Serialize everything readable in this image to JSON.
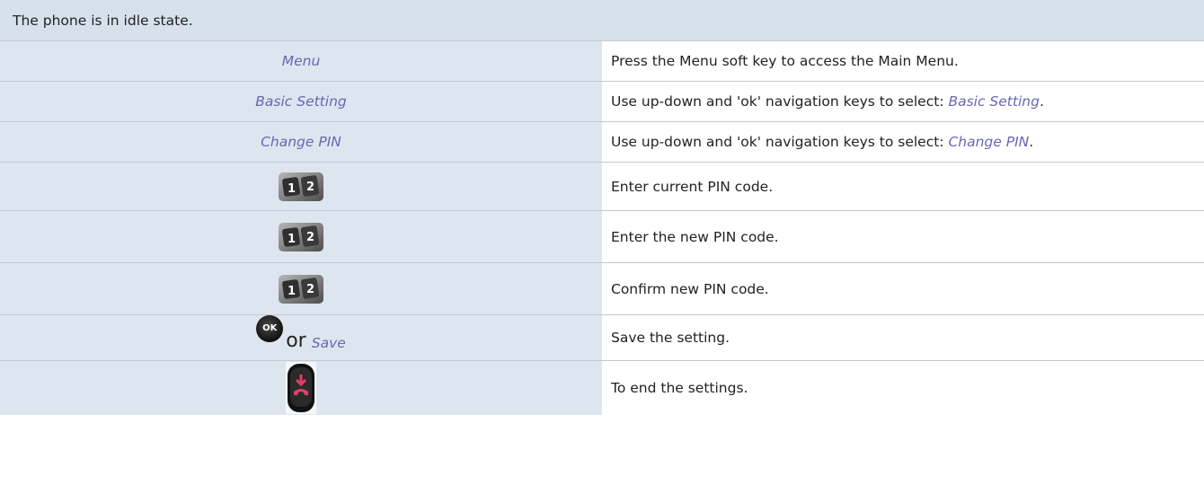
{
  "header": {
    "text": "The phone is in idle state."
  },
  "rows": [
    {
      "left": "Menu",
      "right": "Press the Menu soft key to access the Main Menu."
    },
    {
      "left": "Basic Setting",
      "right_prefix": "Use up-down and 'ok' navigation keys to select: ",
      "right_link": "Basic Setting",
      "right_suffix": "."
    },
    {
      "left": "Change PIN",
      "right_prefix": "Use up-down and 'ok' navigation keys to select: ",
      "right_link": "Change PIN",
      "right_suffix": "."
    },
    {
      "left_icon": "keypad-icon",
      "right": "Enter current PIN code."
    },
    {
      "left_icon": "keypad-icon",
      "right": "Enter the new PIN code."
    },
    {
      "left_icon": "keypad-icon",
      "right": "Confirm new PIN code."
    },
    {
      "left_icon": "ok-button-icon",
      "ok_label": "OK",
      "or_text": "or",
      "left_link": "Save",
      "right": "Save the setting."
    },
    {
      "left_icon": "hang-up-key-icon",
      "right": "To end the settings."
    }
  ],
  "colors": {
    "header_bg": "#d6e1ec",
    "left_bg": "#dde6ef",
    "link": "#6a66b4",
    "border": "#c4c9cf",
    "hangup_red": "#e0406a"
  }
}
